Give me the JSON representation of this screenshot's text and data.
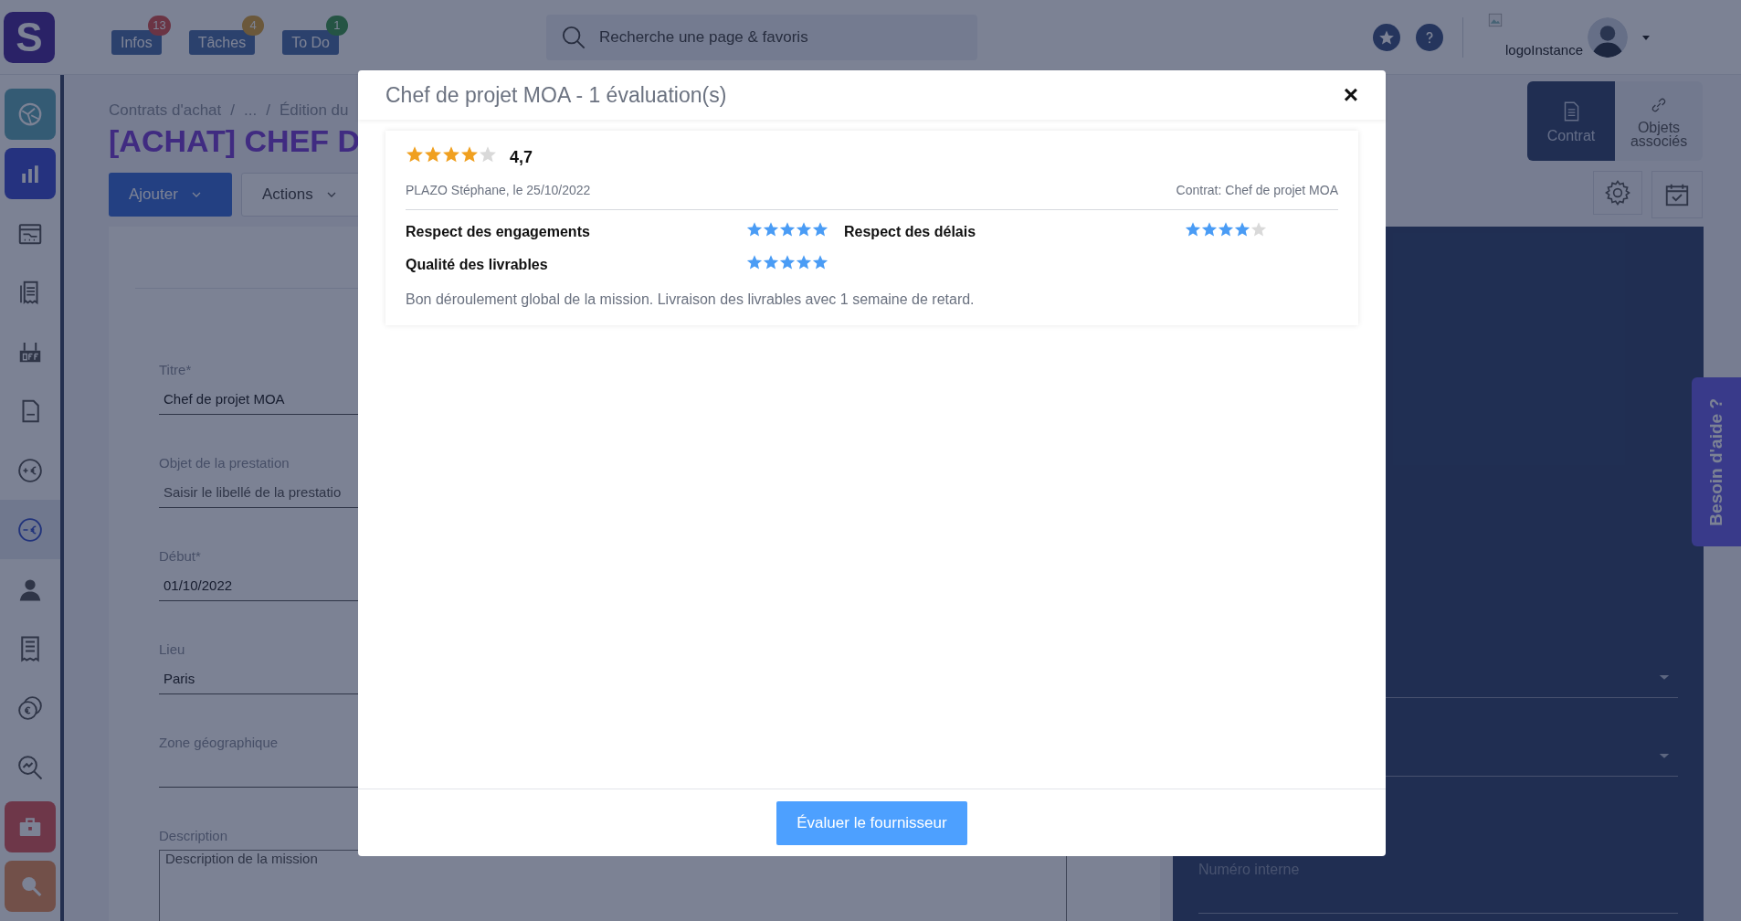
{
  "top_bar": {
    "logo_text": "S",
    "menus": [
      {
        "label": "Infos",
        "badge": "13",
        "kind": "alert"
      },
      {
        "label": "Tâches",
        "badge": "4",
        "kind": "warning"
      },
      {
        "label": "To Do",
        "badge": "1",
        "kind": "success"
      }
    ],
    "search": {
      "placeholder": "Recherche une page & favoris"
    },
    "instance_logo": "logoInstance"
  },
  "sidebar": {
    "items": [
      {
        "selected": false,
        "kind": "teal"
      },
      {
        "selected": false,
        "kind": "indigo"
      },
      {
        "selected": false,
        "kind": "plain"
      },
      {
        "selected": false,
        "kind": "plain"
      },
      {
        "selected": false,
        "kind": "plain"
      },
      {
        "selected": false,
        "kind": "plain"
      },
      {
        "selected": false,
        "kind": "plain"
      },
      {
        "selected": true,
        "kind": "plain"
      },
      {
        "selected": false,
        "kind": "plain"
      },
      {
        "selected": false,
        "kind": "plain"
      },
      {
        "selected": false,
        "kind": "plain"
      },
      {
        "selected": false,
        "kind": "plain"
      },
      {
        "selected": false,
        "kind": "red"
      },
      {
        "selected": false,
        "kind": "orange"
      }
    ]
  },
  "breadcrumb": {
    "items": [
      "Contrats d'achat",
      "...",
      "Édition du"
    ],
    "separator": "/"
  },
  "page_title": "[ACHAT] CHEF D",
  "toolbar": [
    {
      "label": "Ajouter",
      "kind": "primary"
    },
    {
      "label": "Actions",
      "kind": "secondary"
    }
  ],
  "form": {
    "fields": [
      {
        "kind": "text",
        "label": "Titre*",
        "value": "Chef de projet MOA"
      },
      {
        "kind": "text",
        "label": "Objet de la prestation",
        "placeholder": "Saisir le libellé de la prestatio"
      },
      {
        "kind": "text",
        "label": "Début*",
        "value": "01/10/2022"
      },
      {
        "kind": "text",
        "label": "Lieu",
        "value": "Paris"
      },
      {
        "kind": "text",
        "label": "Zone géographique"
      },
      {
        "kind": "textarea",
        "label": "Description",
        "placeholder": "Description de la mission"
      }
    ]
  },
  "side_tabs": [
    {
      "label": "Contrat",
      "selected": true
    },
    {
      "label": "Objets associés",
      "selected": false
    }
  ],
  "right_panel": {
    "fields": [
      {
        "kind": "select"
      },
      {
        "kind": "select"
      },
      {
        "kind": "text",
        "label": "Numéro interne"
      }
    ]
  },
  "help_tab": {
    "label": "Besoin d'aide ?"
  },
  "modal": {
    "title": "Chef de projet MOA - 1 évaluation(s)",
    "close": "×",
    "evaluations": [
      {
        "stars": 4,
        "score": "4,7",
        "author": "PLAZO Stéphane, le 25/10/2022",
        "contract": "Contrat: Chef de projet MOA",
        "criteria": [
          {
            "label": "Respect des engagements",
            "stars": 5
          },
          {
            "label": "Respect des délais",
            "stars": 4
          },
          {
            "label": "Qualité des livrables",
            "stars": 5
          }
        ],
        "comment": "Bon déroulement global de la mission. Livraison des livrables avec 1 semaine de retard."
      }
    ],
    "action": "Évaluer le fournisseur"
  }
}
